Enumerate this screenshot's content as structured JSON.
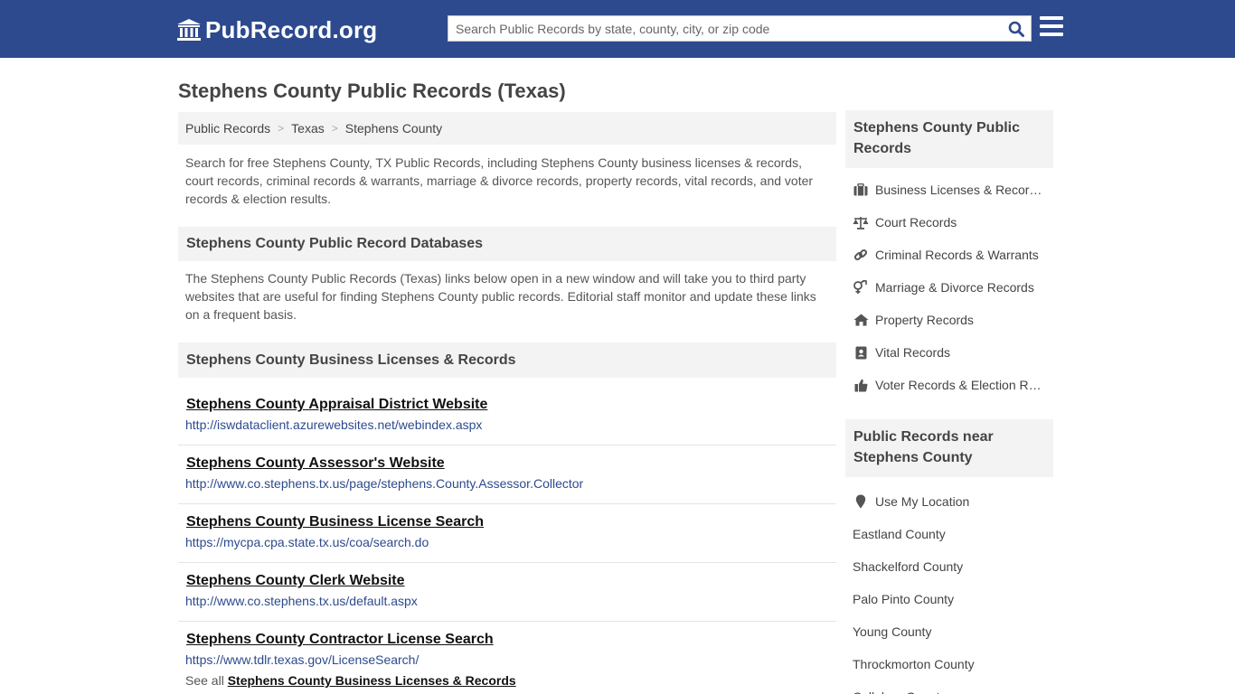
{
  "header": {
    "logo_text": "PubRecord.org",
    "search_placeholder": "Search Public Records by state, county, city, or zip code",
    "brand_color": "#2d4a8e"
  },
  "page": {
    "title": "Stephens County Public Records (Texas)"
  },
  "breadcrumb": [
    "Public Records",
    "Texas",
    "Stephens County"
  ],
  "intro": "Search for free Stephens County, TX Public Records, including Stephens County business licenses & records, court records, criminal records & warrants, marriage & divorce records, property records, vital records, and voter records & election results.",
  "databases": {
    "heading": "Stephens County Public Record Databases",
    "text": "The Stephens County Public Records (Texas) links below open in a new window and will take you to third party websites that are useful for finding Stephens County public records. Editorial staff monitor and update these links on a frequent basis."
  },
  "business": {
    "heading": "Stephens County Business Licenses & Records",
    "links": [
      {
        "title": "Stephens County Appraisal District Website",
        "url": "http://iswdataclient.azurewebsites.net/webindex.aspx"
      },
      {
        "title": "Stephens County Assessor's Website",
        "url": "http://www.co.stephens.tx.us/page/stephens.County.Assessor.Collector"
      },
      {
        "title": "Stephens County Business License Search",
        "url": "https://mycpa.cpa.state.tx.us/coa/search.do"
      },
      {
        "title": "Stephens County Clerk Website",
        "url": "http://www.co.stephens.tx.us/default.aspx"
      },
      {
        "title": "Stephens County Contractor License Search",
        "url": "https://www.tdlr.texas.gov/LicenseSearch/"
      }
    ],
    "see_all_prefix": "See all",
    "see_all_link": "Stephens County Business Licenses & Records"
  },
  "sidebar": {
    "records_heading": "Stephens County Public Records",
    "records": [
      {
        "label": "Business Licenses & Records",
        "icon": "briefcase-icon"
      },
      {
        "label": "Court Records",
        "icon": "scales-icon"
      },
      {
        "label": "Criminal Records & Warrants",
        "icon": "link-icon"
      },
      {
        "label": "Marriage & Divorce Records",
        "icon": "gender-icon"
      },
      {
        "label": "Property Records",
        "icon": "home-icon"
      },
      {
        "label": "Vital Records",
        "icon": "id-card-icon"
      },
      {
        "label": "Voter Records & Election Results",
        "icon": "thumbs-up-icon"
      }
    ],
    "near_heading": "Public Records near Stephens County",
    "use_location": "Use My Location",
    "near": [
      "Eastland County",
      "Shackelford County",
      "Palo Pinto County",
      "Young County",
      "Throckmorton County",
      "Callahan County"
    ]
  }
}
